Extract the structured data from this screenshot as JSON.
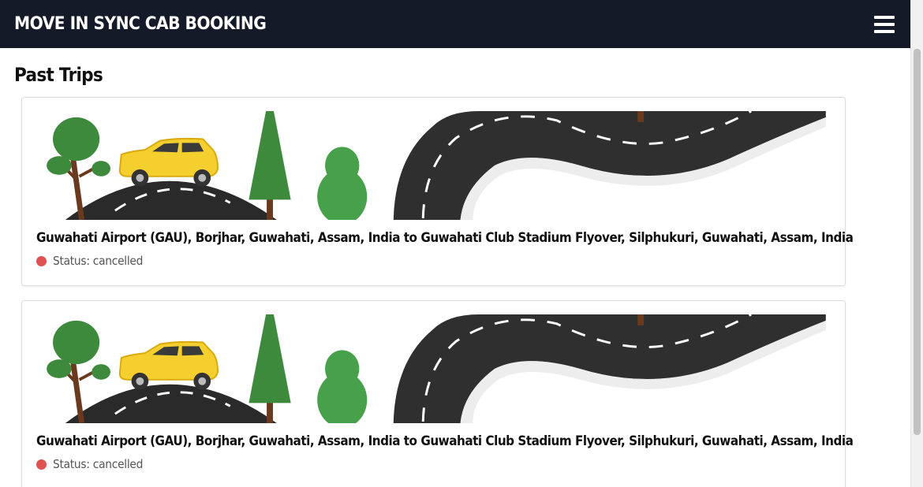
{
  "app": {
    "title": "MOVE IN SYNC CAB BOOKING",
    "menu_icon": "hamburger-menu-icon"
  },
  "page": {
    "title": "Past Trips"
  },
  "trips": [
    {
      "route": "Guwahati Airport (GAU), Borjhar, Guwahati, Assam, India to Guwahati Club Stadium Flyover, Silphukuri, Guwahati, Assam, India",
      "status_text": "Status: cancelled",
      "status_color": "#e05252"
    },
    {
      "route": "Guwahati Airport (GAU), Borjhar, Guwahati, Assam, India to Guwahati Club Stadium Flyover, Silphukuri, Guwahati, Assam, India",
      "status_text": "Status: cancelled",
      "status_color": "#e05252"
    }
  ],
  "colors": {
    "navbar": "#141a28",
    "road": "#2c2c2c",
    "tree": "#3d8a3d",
    "car": "#f7d23a"
  }
}
